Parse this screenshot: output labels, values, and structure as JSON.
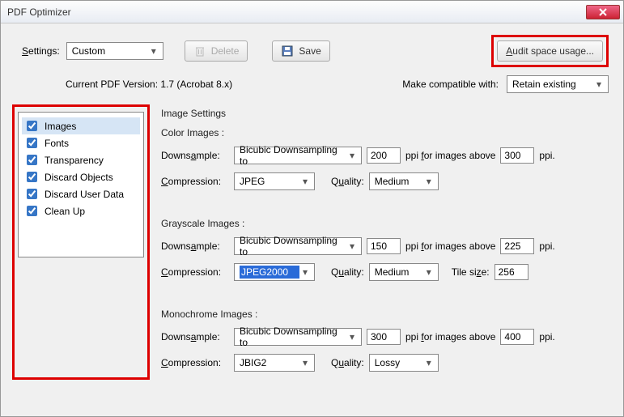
{
  "window": {
    "title": "PDF Optimizer"
  },
  "toolbar": {
    "settings_label": "Settings:",
    "settings_value": "Custom",
    "delete_label": "Delete",
    "save_label": "Save",
    "audit_label": "Audit space usage..."
  },
  "version": {
    "current_label": "Current PDF Version:",
    "current_value": "1.7 (Acrobat 8.x)",
    "compat_label": "Make compatible with:",
    "compat_value": "Retain existing"
  },
  "sidebar": {
    "items": [
      {
        "label": "Images",
        "checked": true,
        "selected": true
      },
      {
        "label": "Fonts",
        "checked": true
      },
      {
        "label": "Transparency",
        "checked": true
      },
      {
        "label": "Discard Objects",
        "checked": true
      },
      {
        "label": "Discard User Data",
        "checked": true
      },
      {
        "label": "Clean Up",
        "checked": true
      }
    ]
  },
  "panel": {
    "title": "Image Settings",
    "color": {
      "header": "Color Images :",
      "downsample_label": "Downsample:",
      "downsample_value": "Bicubic Downsampling to",
      "ppi1": "200",
      "above_label": "ppi for images above",
      "ppi2": "300",
      "ppi_suffix": "ppi.",
      "compression_label": "Compression:",
      "compression_value": "JPEG",
      "quality_label": "Quality:",
      "quality_value": "Medium"
    },
    "gray": {
      "header": "Grayscale Images :",
      "downsample_label": "Downsample:",
      "downsample_value": "Bicubic Downsampling to",
      "ppi1": "150",
      "above_label": "ppi for images above",
      "ppi2": "225",
      "ppi_suffix": "ppi.",
      "compression_label": "Compression:",
      "compression_value": "JPEG2000",
      "quality_label": "Quality:",
      "quality_value": "Medium",
      "tile_label": "Tile size:",
      "tile_value": "256"
    },
    "mono": {
      "header": "Monochrome Images :",
      "downsample_label": "Downsample:",
      "downsample_value": "Bicubic Downsampling to",
      "ppi1": "300",
      "above_label": "ppi for images above",
      "ppi2": "400",
      "ppi_suffix": "ppi.",
      "compression_label": "Compression:",
      "compression_value": "JBIG2",
      "quality_label": "Quality:",
      "quality_value": "Lossy"
    }
  }
}
